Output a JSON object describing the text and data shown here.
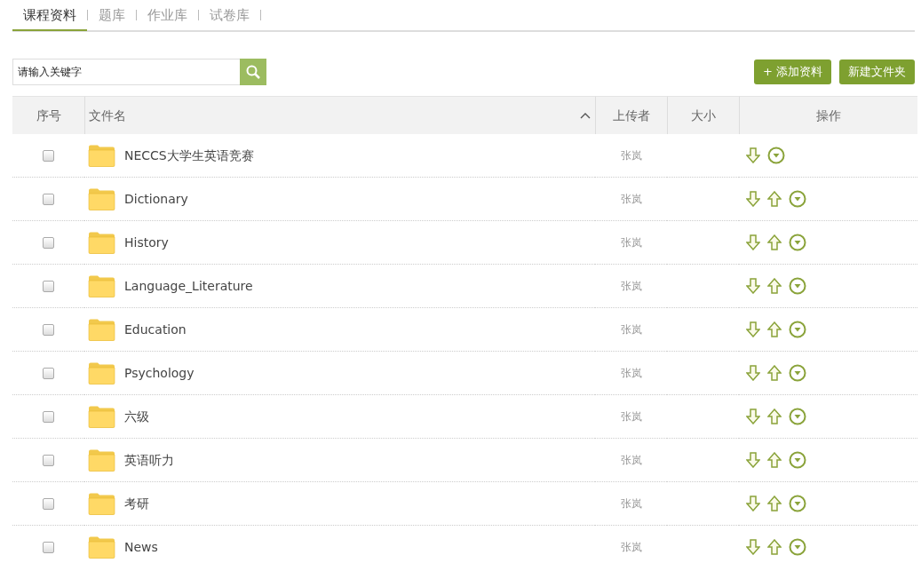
{
  "tabs": [
    {
      "label": "课程资料",
      "selected": true
    },
    {
      "label": "题库",
      "selected": false
    },
    {
      "label": "作业库",
      "selected": false
    },
    {
      "label": "试卷库",
      "selected": false
    }
  ],
  "search": {
    "placeholder": "请输入关键字"
  },
  "buttons": [
    {
      "label": "+ 添加资料"
    },
    {
      "label": "新建文件夹"
    }
  ],
  "table": {
    "columns": [
      {
        "label": "序号"
      },
      {
        "label": "文件名",
        "sort_ascending": true
      },
      {
        "label": "上传者"
      },
      {
        "label": "大小"
      },
      {
        "label": "操作"
      }
    ],
    "rows": [
      {
        "checked": false,
        "name": "NECCS大学生英语竞赛",
        "uploader": "张岚",
        "actions": [
          {
            "kind": "down"
          },
          {
            "kind": "more"
          }
        ]
      },
      {
        "checked": false,
        "name": "Dictionary",
        "uploader": "张岚",
        "actions": [
          {
            "kind": "down"
          },
          {
            "kind": "up"
          },
          {
            "kind": "more"
          }
        ]
      },
      {
        "checked": false,
        "name": "History",
        "uploader": "张岚",
        "actions": [
          {
            "kind": "down"
          },
          {
            "kind": "up"
          },
          {
            "kind": "more"
          }
        ]
      },
      {
        "checked": false,
        "name": "Language_Literature",
        "uploader": "张岚",
        "actions": [
          {
            "kind": "down"
          },
          {
            "kind": "up"
          },
          {
            "kind": "more"
          }
        ]
      },
      {
        "checked": false,
        "name": "Education",
        "uploader": "张岚",
        "actions": [
          {
            "kind": "down"
          },
          {
            "kind": "up"
          },
          {
            "kind": "more"
          }
        ]
      },
      {
        "checked": false,
        "name": "Psychology",
        "uploader": "张岚",
        "actions": [
          {
            "kind": "down"
          },
          {
            "kind": "up"
          },
          {
            "kind": "more"
          }
        ]
      },
      {
        "checked": false,
        "name": "六级",
        "uploader": "张岚",
        "actions": [
          {
            "kind": "down"
          },
          {
            "kind": "up"
          },
          {
            "kind": "more"
          }
        ]
      },
      {
        "checked": false,
        "name": "英语听力",
        "uploader": "张岚",
        "actions": [
          {
            "kind": "down"
          },
          {
            "kind": "up"
          },
          {
            "kind": "more"
          }
        ]
      },
      {
        "checked": false,
        "name": "考研",
        "uploader": "张岚",
        "actions": [
          {
            "kind": "down"
          },
          {
            "kind": "up"
          },
          {
            "kind": "more"
          }
        ]
      },
      {
        "checked": false,
        "name": "News",
        "uploader": "张岚",
        "actions": [
          {
            "kind": "down"
          },
          {
            "kind": "up"
          },
          {
            "kind": "more"
          }
        ]
      }
    ]
  }
}
